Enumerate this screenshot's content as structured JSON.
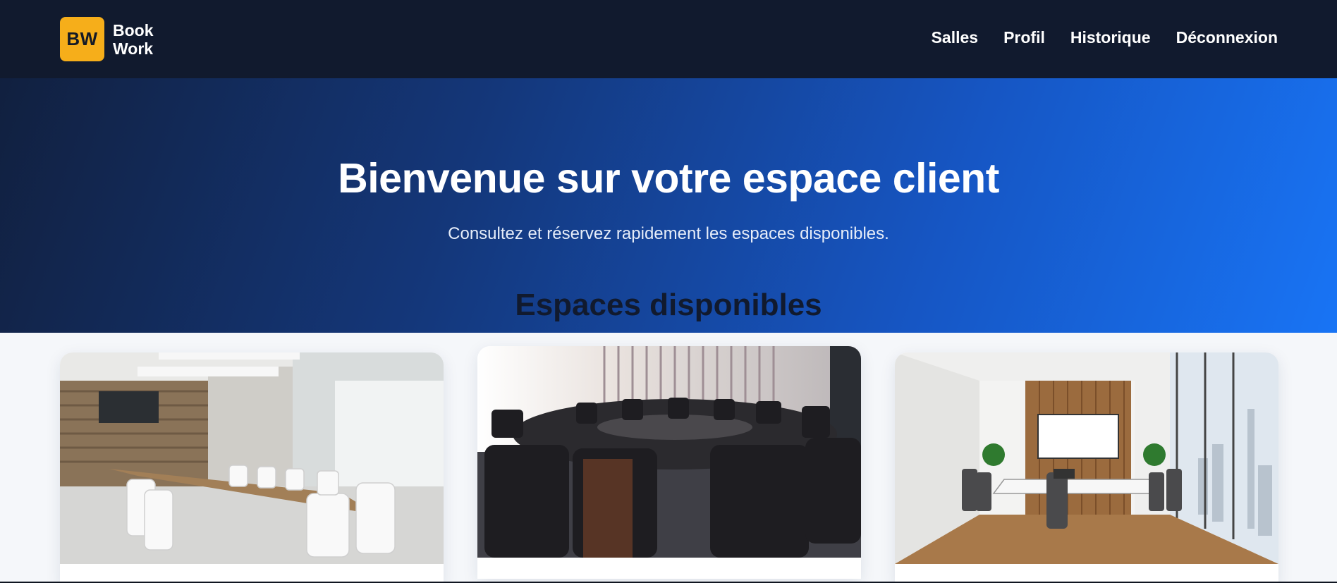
{
  "header": {
    "logo_text": "BW",
    "brand_line1": "Book",
    "brand_line2": "Work",
    "nav": [
      {
        "label": "Salles"
      },
      {
        "label": "Profil"
      },
      {
        "label": "Historique"
      },
      {
        "label": "Déconnexion"
      }
    ]
  },
  "hero": {
    "title": "Bienvenue sur votre espace client",
    "subtitle": "Consultez et réservez rapidement les espaces disponibles."
  },
  "section": {
    "title": "Espaces disponibles"
  },
  "colors": {
    "header_bg": "#111a2e",
    "logo_bg": "#f6ae1a",
    "hero_start": "#11203f",
    "hero_end": "#1874f5"
  },
  "cards": [
    {
      "image": "meeting-room-white-chairs-photo"
    },
    {
      "image": "round-table-black-chairs-photo"
    },
    {
      "image": "meeting-room-wood-wall-city-view-photo"
    }
  ]
}
